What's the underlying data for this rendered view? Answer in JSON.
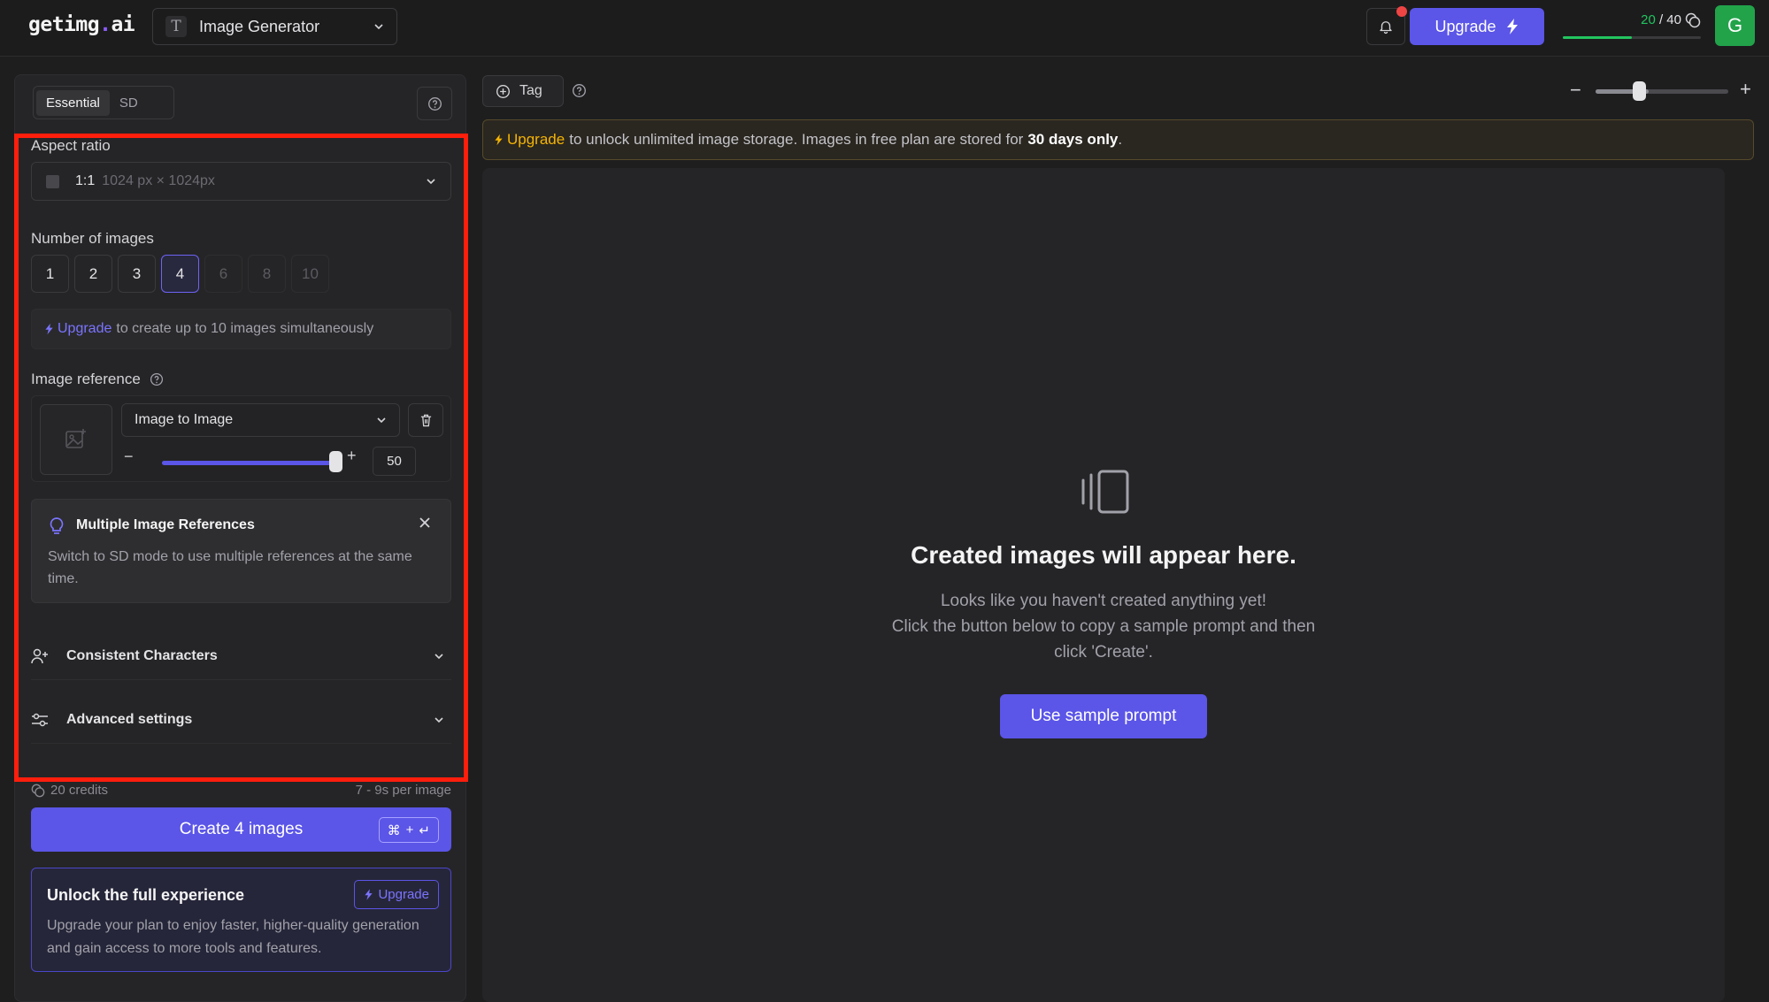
{
  "app": {
    "logo_main": "getimg",
    "logo_dot": ".",
    "logo_tail": "ai",
    "tool_selector": {
      "icon": "T",
      "label": "Image Generator"
    },
    "upgrade_label": "Upgrade",
    "credits": {
      "used": "20",
      "total": "/ 40",
      "fill_fraction": 0.5
    },
    "avatar_letter": "G"
  },
  "sidebar": {
    "tabs": [
      {
        "label": "Essential",
        "active": true
      },
      {
        "label": "SD",
        "active": false
      }
    ],
    "aspect_ratio": {
      "label": "Aspect ratio",
      "ratio": "1:1",
      "dims": "1024 px × 1024px"
    },
    "num_images": {
      "label": "Number of images",
      "options": [
        "1",
        "2",
        "3",
        "4",
        "6",
        "8",
        "10"
      ],
      "selected": "4",
      "disabled": [
        "6",
        "8",
        "10"
      ]
    },
    "upsell": {
      "link": "Upgrade",
      "text": "to create up to 10 images simultaneously"
    },
    "image_reference": {
      "label": "Image reference",
      "mode": "Image to Image",
      "strength": "50",
      "strength_fraction": 0.98
    },
    "tip": {
      "title": "Multiple Image References",
      "body": "Switch to SD mode to use multiple references at the same time."
    },
    "accordions": [
      {
        "label": "Consistent Characters"
      },
      {
        "label": "Advanced settings"
      }
    ],
    "footer": {
      "credits": "20 credits",
      "speed": "7 - 9s per image"
    },
    "create_button": {
      "label": "Create 4 images",
      "shortcut_cmd": "⌘",
      "shortcut_plus": "+",
      "shortcut_enter": "↵"
    },
    "unlock": {
      "title": "Unlock the full experience",
      "button": "Upgrade",
      "body": "Upgrade your plan to enjoy faster, higher-quality generation and gain access to more tools and features."
    }
  },
  "main": {
    "tag_label": "Tag",
    "zoom_fraction": 0.4,
    "banner": {
      "link": "Upgrade",
      "text": "to unlock unlimited image storage. Images in free plan are stored for",
      "strong": "30 days only",
      "end": "."
    },
    "empty": {
      "title": "Created images will appear here.",
      "line1": "Looks like you haven't created anything yet!",
      "line2": "Click the button below to copy a sample prompt and then",
      "line3": "click 'Create'."
    },
    "sample_button": "Use sample prompt"
  },
  "colors": {
    "accent": "#5b55e8",
    "highlight_box": "#ff1e0c",
    "banner_link": "#f5b400",
    "credits_green": "#22c55e"
  },
  "icons": [
    "bell-icon",
    "lightning-icon",
    "coin-icon",
    "chevron-down-icon",
    "help-icon",
    "image-placeholder-icon",
    "trash-icon",
    "bulb-icon",
    "close-icon",
    "user-plus-icon",
    "sliders-icon",
    "plus-circle-icon",
    "gallery-icon"
  ]
}
